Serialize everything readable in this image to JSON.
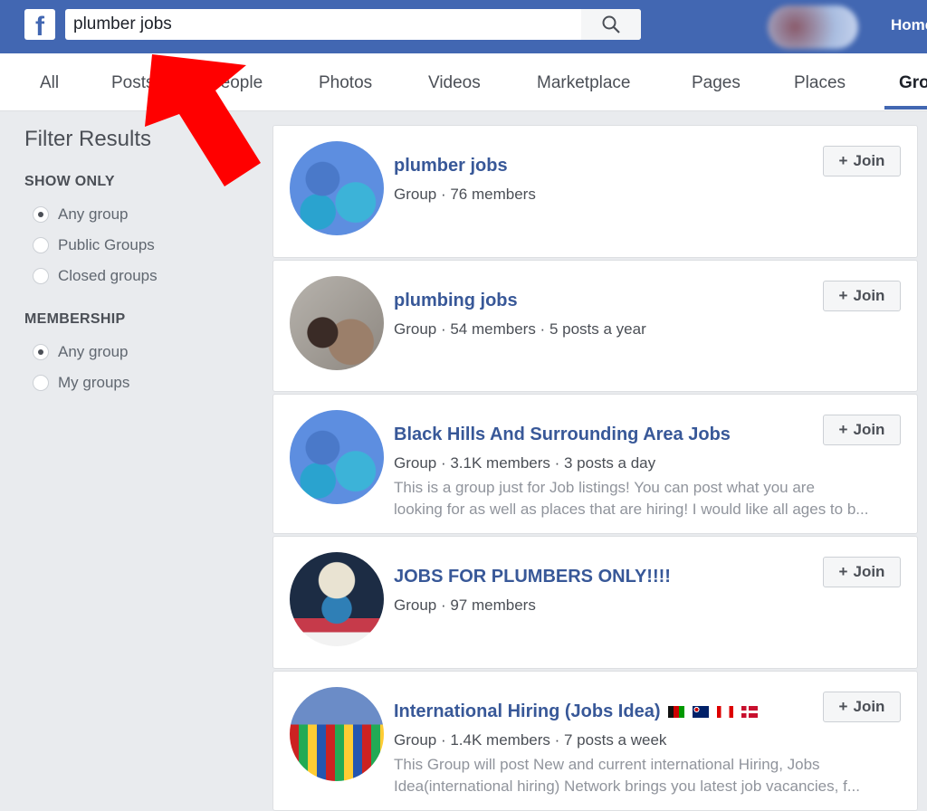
{
  "header": {
    "logo": "f",
    "search_value": "plumber jobs",
    "home_label": "Home"
  },
  "tabs": [
    "All",
    "Posts",
    "People",
    "Photos",
    "Videos",
    "Marketplace",
    "Pages",
    "Places",
    "Groups"
  ],
  "filter": {
    "title": "Filter Results",
    "show_only": {
      "label": "SHOW ONLY",
      "options": [
        "Any group",
        "Public Groups",
        "Closed groups"
      ],
      "selected": "Any group"
    },
    "membership": {
      "label": "MEMBERSHIP",
      "options": [
        "Any group",
        "My groups"
      ],
      "selected": "Any group"
    }
  },
  "join_label": "Join",
  "groups": [
    {
      "name": "plumber jobs",
      "meta": "Group · 76 members",
      "desc": []
    },
    {
      "name": "plumbing jobs",
      "meta": "Group · 54 members · 5 posts a year",
      "desc": []
    },
    {
      "name": "Black Hills And Surrounding Area Jobs",
      "meta": "Group · 3.1K members · 3 posts a day",
      "desc": [
        "This is a group just for Job listings! You can post what you are",
        "looking for as well as places that are hiring! I would like all ages to b..."
      ]
    },
    {
      "name": "JOBS FOR PLUMBERS ONLY!!!!",
      "meta": "Group · 97 members",
      "desc": []
    },
    {
      "name": "International Hiring (Jobs Idea)",
      "flags": [
        "afghanistan-flag",
        "australia-flag",
        "canada-flag",
        "denmark-flag"
      ],
      "meta": "Group · 1.4K members · 7 posts a week",
      "desc": [
        "This Group will post New and current international Hiring, Jobs",
        "Idea(international hiring) Network brings you latest job vacancies, f..."
      ]
    }
  ],
  "colors": {
    "brand": "#4267b2",
    "link": "#385898",
    "annotation_arrow": "#ff0000"
  }
}
